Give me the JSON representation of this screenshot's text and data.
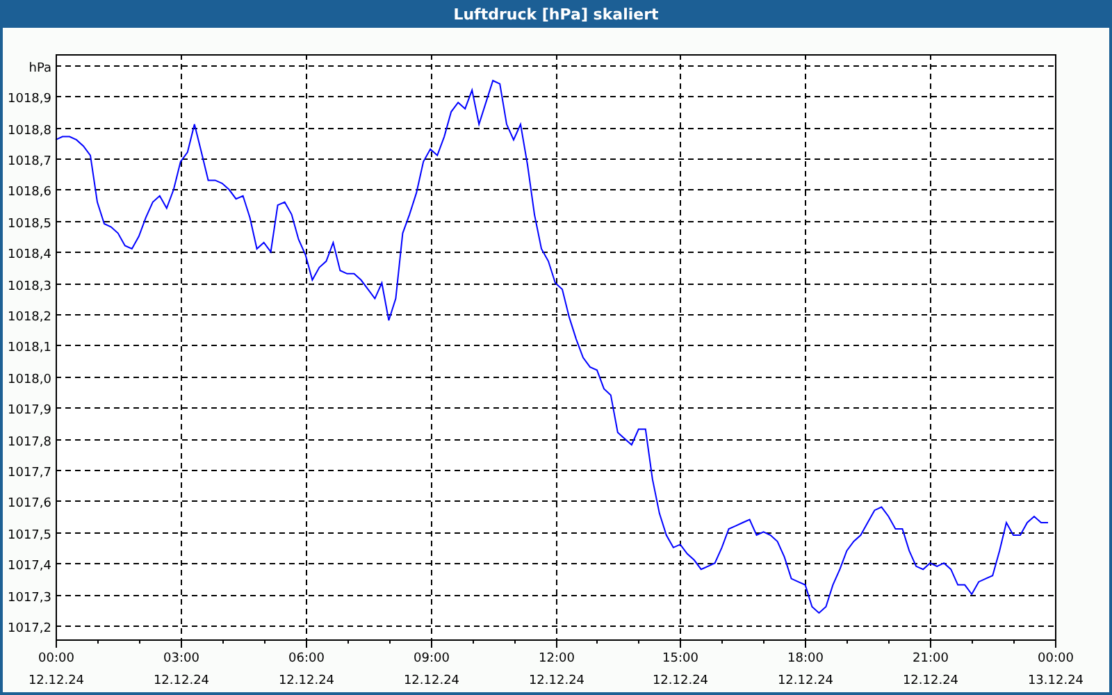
{
  "window": {
    "title": "Luftdruck [hPa] skaliert"
  },
  "chart": {
    "chart_data": {
      "type": "line",
      "grid": true,
      "ylim": [
        1017.155,
        1019.035
      ],
      "categories": [
        "00:00\n12.12.24",
        null,
        null,
        null,
        null,
        null,
        null,
        null,
        null,
        null,
        null,
        null,
        null,
        null,
        null,
        null,
        null,
        null,
        "03:00\n12.12.24",
        null,
        null,
        null,
        null,
        null,
        null,
        null,
        null,
        null,
        null,
        null,
        null,
        null,
        null,
        null,
        null,
        null,
        "06:00\n12.12.24",
        null,
        null,
        null,
        null,
        null,
        null,
        null,
        null,
        null,
        null,
        null,
        null,
        null,
        null,
        null,
        null,
        null,
        "09:00\n12.12.24",
        null,
        null,
        null,
        null,
        null,
        null,
        null,
        null,
        null,
        null,
        null,
        null,
        null,
        null,
        null,
        null,
        null,
        "12:00\n12.12.24",
        null,
        null,
        null,
        null,
        null,
        null,
        null,
        null,
        null,
        null,
        null,
        null,
        null,
        null,
        null,
        null,
        null,
        "15:00\n12.12.24",
        null,
        null,
        null,
        null,
        null,
        null,
        null,
        null,
        null,
        null,
        null,
        null,
        null,
        null,
        null,
        null,
        null,
        "18:00\n12.12.24",
        null,
        null,
        null,
        null,
        null,
        null,
        null,
        null,
        null,
        null,
        null,
        null,
        null,
        null,
        null,
        null,
        null,
        "21:00\n12.12.24",
        null,
        null,
        null,
        null,
        null,
        null,
        null,
        null,
        null,
        null,
        null,
        null,
        null,
        null,
        null,
        null,
        null,
        "00:00\n13.12.24"
      ],
      "yticks": [
        {
          "value": 1017.2,
          "label": "1017,2"
        },
        {
          "value": 1017.3,
          "label": "1017,3"
        },
        {
          "value": 1017.4,
          "label": "1017,4"
        },
        {
          "value": 1017.5,
          "label": "1017,5"
        },
        {
          "value": 1017.6,
          "label": "1017,6"
        },
        {
          "value": 1017.7,
          "label": "1017,7"
        },
        {
          "value": 1017.8,
          "label": "1017,8"
        },
        {
          "value": 1017.9,
          "label": "1017,9"
        },
        {
          "value": 1018.0,
          "label": "1018,0"
        },
        {
          "value": 1018.1,
          "label": "1018,1"
        },
        {
          "value": 1018.2,
          "label": "1018,2"
        },
        {
          "value": 1018.3,
          "label": "1018,3"
        },
        {
          "value": 1018.4,
          "label": "1018,4"
        },
        {
          "value": 1018.5,
          "label": "1018,5"
        },
        {
          "value": 1018.6,
          "label": "1018,6"
        },
        {
          "value": 1018.7,
          "label": "1018,7"
        },
        {
          "value": 1018.8,
          "label": "1018,8"
        },
        {
          "value": 1018.9,
          "label": "1018,9"
        },
        {
          "value": 1019.0,
          "label": "hPa"
        }
      ],
      "series": [
        {
          "color": "#0000ff",
          "values": [
            1018.76,
            1018.77,
            1018.77,
            1018.76,
            1018.74,
            1018.71,
            1018.56,
            1018.49,
            1018.48,
            1018.46,
            1018.42,
            1018.41,
            1018.45,
            1018.51,
            1018.56,
            1018.58,
            1018.54,
            1018.6,
            1018.69,
            1018.72,
            1018.81,
            1018.72,
            1018.63,
            1018.63,
            1018.62,
            1018.6,
            1018.57,
            1018.58,
            1018.51,
            1018.41,
            1018.43,
            1018.4,
            1018.55,
            1018.56,
            1018.52,
            1018.44,
            1018.39,
            1018.31,
            1018.35,
            1018.37,
            1018.43,
            1018.34,
            1018.33,
            1018.33,
            1018.31,
            1018.28,
            1018.25,
            1018.3,
            1018.18,
            1018.25,
            1018.46,
            1018.52,
            1018.59,
            1018.69,
            1018.73,
            1018.71,
            1018.77,
            1018.85,
            1018.88,
            1018.86,
            1018.92,
            1018.81,
            1018.88,
            1018.95,
            1018.94,
            1018.81,
            1018.76,
            1018.81,
            1018.68,
            1018.52,
            1018.41,
            1018.37,
            1018.3,
            1018.28,
            1018.19,
            1018.12,
            1018.06,
            1018.03,
            1018.02,
            1017.96,
            1017.94,
            1017.82,
            1017.8,
            1017.78,
            1017.83,
            1017.83,
            1017.67,
            1017.56,
            1017.49,
            1017.45,
            1017.46,
            1017.43,
            1017.41,
            1017.38,
            1017.39,
            1017.4,
            1017.45,
            1017.51,
            1017.52,
            1017.53,
            1017.54,
            1017.49,
            1017.5,
            1017.49,
            1017.47,
            1017.42,
            1017.35,
            1017.34,
            1017.33,
            1017.26,
            1017.24,
            1017.26,
            1017.33,
            1017.38,
            1017.44,
            1017.47,
            1017.49,
            1017.53,
            1017.57,
            1017.58,
            1017.55,
            1017.51,
            1017.51,
            1017.44,
            1017.39,
            1017.38,
            1017.4,
            1017.39,
            1017.4,
            1017.38,
            1017.33,
            1017.33,
            1017.3,
            1017.34,
            1017.35,
            1017.36,
            1017.44,
            1017.53,
            1017.49,
            1017.49,
            1017.53,
            1017.55,
            1017.53,
            1017.53,
            null
          ]
        }
      ]
    }
  }
}
